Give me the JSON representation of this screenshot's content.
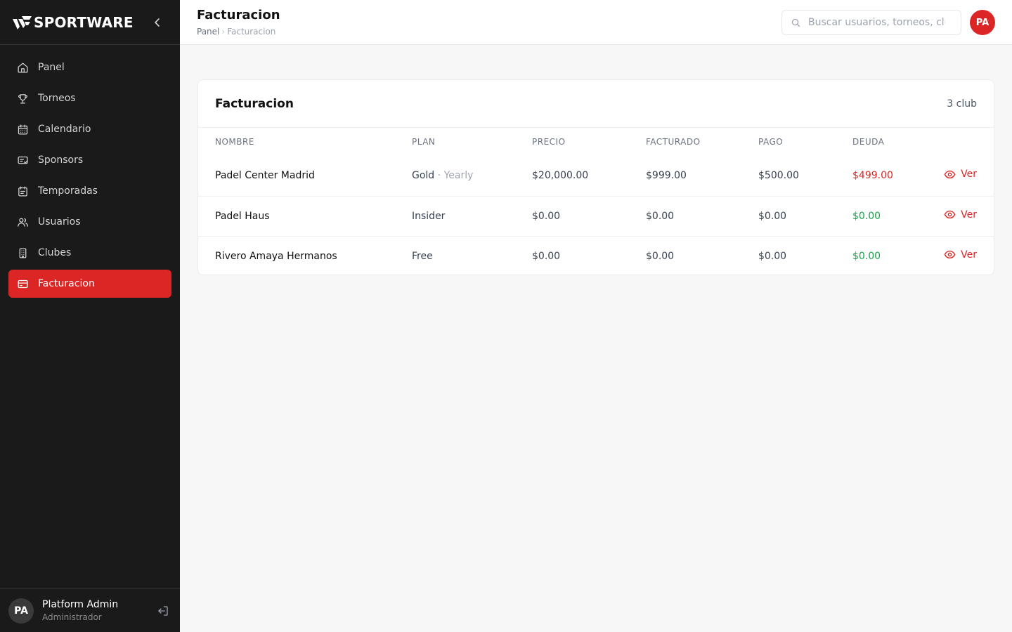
{
  "brand": {
    "name": "SPORTWARE"
  },
  "sidebar": {
    "items": [
      {
        "label": "Panel",
        "icon": "home-icon"
      },
      {
        "label": "Torneos",
        "icon": "trophy-icon"
      },
      {
        "label": "Calendario",
        "icon": "calendar-icon"
      },
      {
        "label": "Sponsors",
        "icon": "sponsor-icon"
      },
      {
        "label": "Temporadas",
        "icon": "season-icon"
      },
      {
        "label": "Usuarios",
        "icon": "users-icon"
      },
      {
        "label": "Clubes",
        "icon": "building-icon"
      },
      {
        "label": "Facturacion",
        "icon": "billing-card-icon",
        "active": true
      }
    ],
    "user": {
      "initials": "PA",
      "name": "Platform Admin",
      "role": "Administrador"
    }
  },
  "header": {
    "title": "Facturacion",
    "breadcrumb": {
      "root": "Panel",
      "separator": "›",
      "current": "Facturacion"
    },
    "search_placeholder": "Buscar usuarios, torneos, clubes...",
    "avatar_initials": "PA"
  },
  "card": {
    "title": "Facturacion",
    "count": "3 club",
    "columns": [
      "Nombre",
      "Plan",
      "Precio",
      "Facturado",
      "Pago",
      "Deuda"
    ],
    "rows": [
      {
        "name": "Padel Center Madrid",
        "plan": "Gold",
        "plan_sep": " · ",
        "plan_period": "Yearly",
        "price": "$20,000.00",
        "billed": "$999.00",
        "paid": "$500.00",
        "debt": "$499.00",
        "debt_state": "pos",
        "action": "Ver"
      },
      {
        "name": "Padel Haus",
        "plan": "Insider",
        "plan_sep": "",
        "plan_period": "",
        "price": "$0.00",
        "billed": "$0.00",
        "paid": "$0.00",
        "debt": "$0.00",
        "debt_state": "zero",
        "action": "Ver"
      },
      {
        "name": "Rivero Amaya Hermanos",
        "plan": "Free",
        "plan_sep": "",
        "plan_period": "",
        "price": "$0.00",
        "billed": "$0.00",
        "paid": "$0.00",
        "debt": "$0.00",
        "debt_state": "zero",
        "action": "Ver"
      }
    ]
  },
  "colors": {
    "accent": "#dc2626",
    "sidebar_bg": "#1a1a1a",
    "positive": "#16a34a"
  }
}
